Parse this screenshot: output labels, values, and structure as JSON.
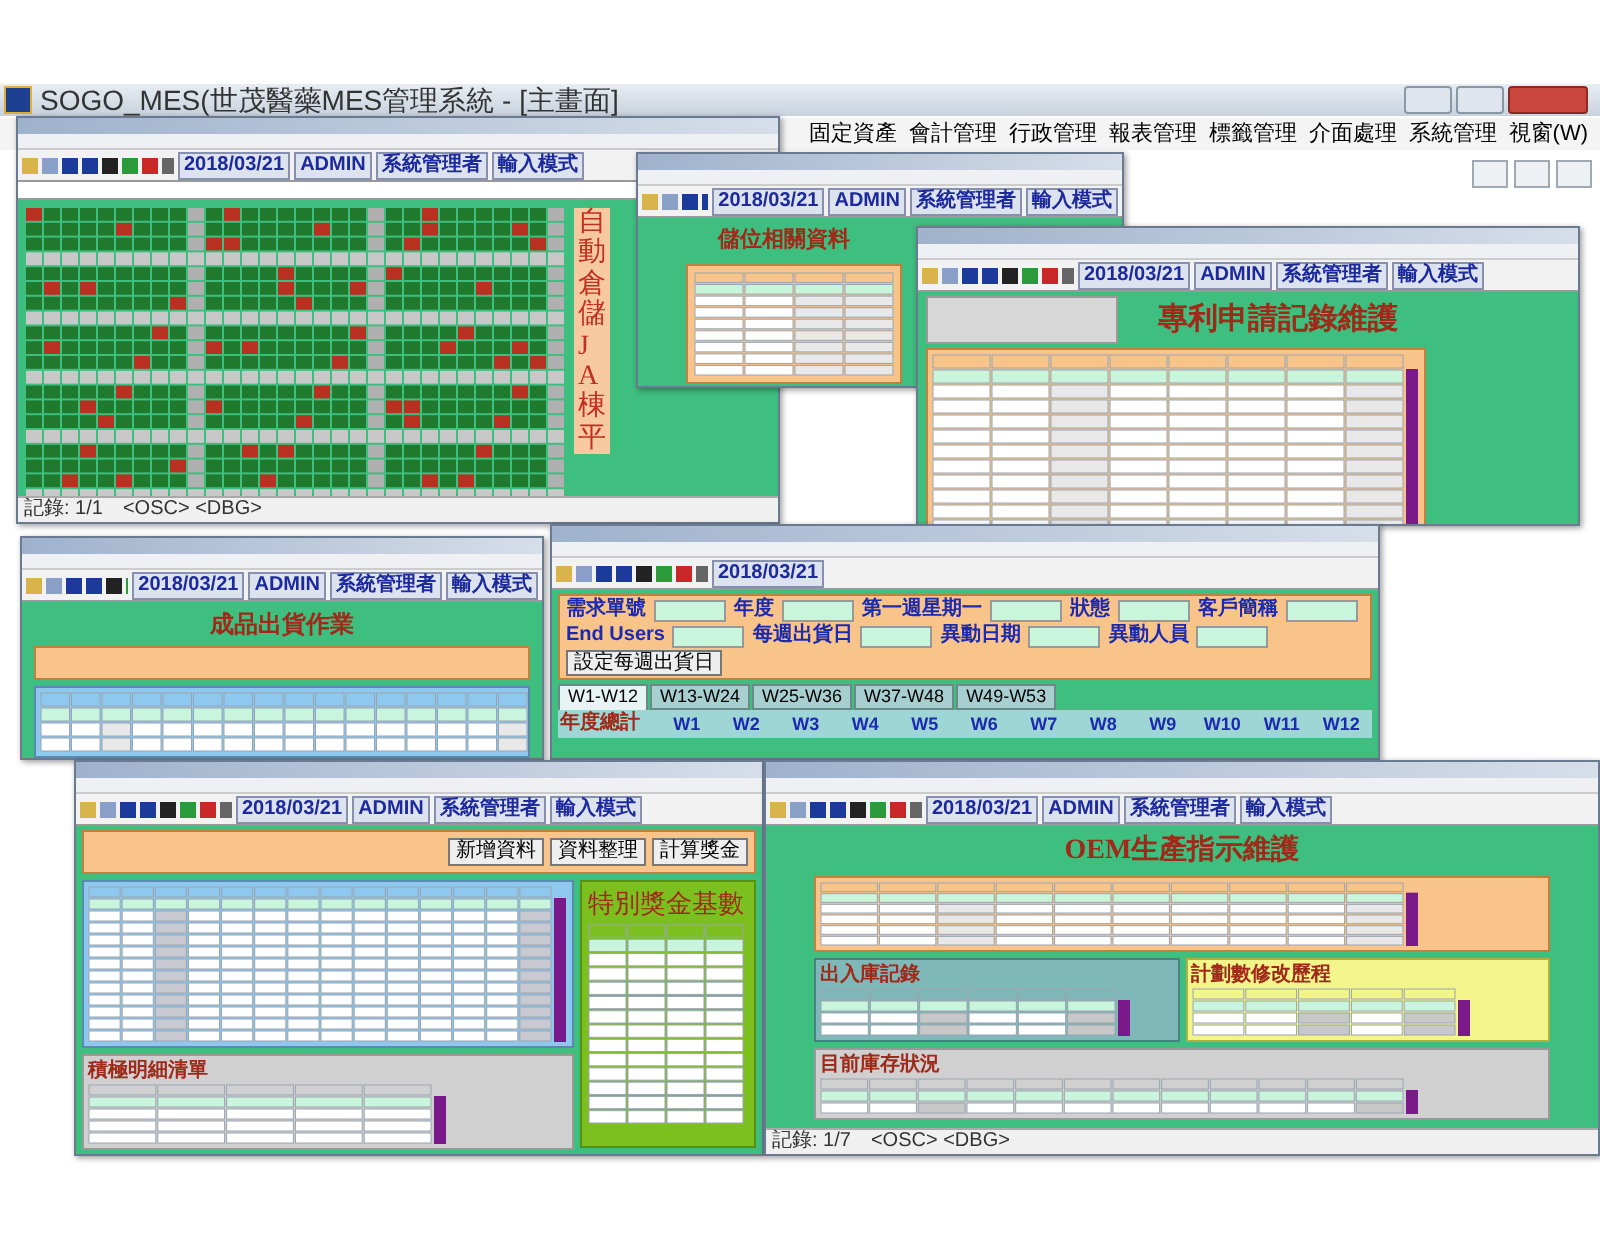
{
  "main_window": {
    "title": "SOGO_MES(世茂醫藥MES管理系統 - [主畫面]",
    "menu": [
      "固定資產",
      "會計管理",
      "行政管理",
      "報表管理",
      "標籤管理",
      "介面處理",
      "系統管理",
      "視窗(W)"
    ]
  },
  "windows": [
    {
      "kind": "storage",
      "toolbar": [
        "2018/03/21",
        "ADMIN",
        "系統管理者",
        "輸入模式"
      ],
      "heading": "自動倉儲JA棟平",
      "status": [
        "記錄: 1/1",
        "<OSC> <DBG>"
      ]
    },
    {
      "kind": "location",
      "toolbar": [
        "2018/03/21",
        "ADMIN",
        "系統管理者",
        "輸入模式"
      ],
      "heading": "儲位相關資料"
    },
    {
      "kind": "patent",
      "toolbar": [
        "2018/03/21",
        "ADMIN",
        "系統管理者",
        "輸入模式"
      ],
      "heading": "專利申請記錄維護"
    },
    {
      "kind": "shipping",
      "toolbar": [
        "2018/03/21",
        "ADMIN",
        "系統管理者",
        "輸入模式"
      ],
      "heading": "成品出貨作業"
    },
    {
      "kind": "weekly",
      "toolbar": [
        "2018/03/21"
      ],
      "form": [
        "需求單號",
        "年度",
        "第一週星期一",
        "狀態",
        "客戶簡稱",
        "End Users",
        "每週出貨日",
        "異動日期",
        "異動人員"
      ],
      "button": "設定每週出貨日",
      "tabs": [
        {
          "label": "W1-W12",
          "selected": true
        },
        {
          "label": "W13-W24",
          "selected": false
        },
        {
          "label": "W25-W36",
          "selected": false
        },
        {
          "label": "W37-W48",
          "selected": false
        },
        {
          "label": "W49-W53",
          "selected": false
        }
      ],
      "row_label": "年度總計",
      "columns": [
        "W1",
        "W2",
        "W3",
        "W4",
        "W5",
        "W6",
        "W7",
        "W8",
        "W9",
        "W10",
        "W11",
        "W12"
      ]
    },
    {
      "kind": "bonus",
      "toolbar": [
        "2018/03/21",
        "ADMIN",
        "系統管理者",
        "輸入模式"
      ],
      "buttons": [
        "新增資料",
        "資料整理",
        "計算獎金"
      ],
      "heading": "特別獎金基數",
      "sub_heading": "積極明細清單"
    },
    {
      "kind": "oem",
      "toolbar": [
        "2018/03/21",
        "ADMIN",
        "系統管理者",
        "輸入模式"
      ],
      "heading": "OEM生產指示維護",
      "sections": [
        "出入庫記錄",
        "計劃數修改歷程",
        "目前庫存狀況"
      ],
      "status": [
        "記錄: 1/7",
        "<OSC> <DBG>"
      ]
    }
  ]
}
